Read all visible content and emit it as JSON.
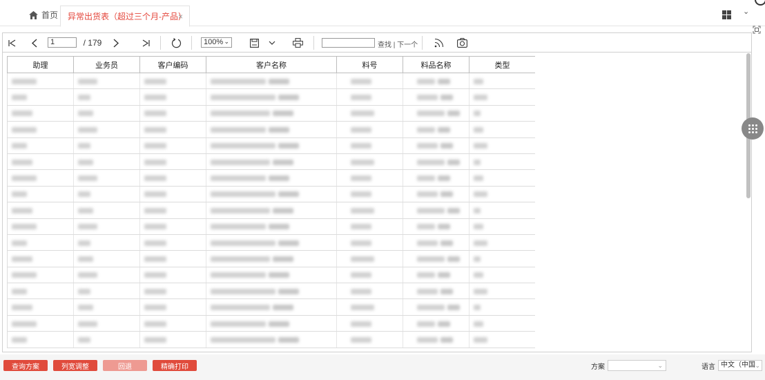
{
  "tabs": {
    "home_label": "首页",
    "active_label": "异常出货表（超过三个月-产品）",
    "close_glyph": "×"
  },
  "toolbar": {
    "first_page": "|◁",
    "prev_page": "〈",
    "page_current": "1",
    "page_total": "/ 179",
    "next_page": "〉",
    "last_page": "▷|",
    "zoom_value": "100%",
    "find_label": "查找 | 下一个"
  },
  "table": {
    "headers": [
      "助理",
      "业务员",
      "客户编码",
      "客户名称",
      "料号",
      "料品名称",
      "类型"
    ],
    "rows": [
      [
        "",
        "",
        "",
        "",
        "",
        "",
        ""
      ],
      [
        "",
        "",
        "",
        "",
        "",
        "",
        ""
      ],
      [
        "",
        "",
        "",
        "",
        "",
        "",
        ""
      ],
      [
        "",
        "",
        "",
        "",
        "",
        "",
        ""
      ],
      [
        "",
        "",
        "",
        "",
        "",
        "",
        ""
      ],
      [
        "",
        "",
        "",
        "",
        "",
        "",
        ""
      ],
      [
        "",
        "",
        "",
        "",
        "",
        "",
        ""
      ],
      [
        "",
        "",
        "",
        "",
        "",
        "",
        ""
      ],
      [
        "",
        "",
        "",
        "",
        "",
        "",
        ""
      ],
      [
        "",
        "",
        "",
        "",
        "",
        "",
        ""
      ],
      [
        "",
        "",
        "",
        "",
        "",
        "",
        ""
      ],
      [
        "",
        "",
        "",
        "",
        "",
        "",
        ""
      ],
      [
        "",
        "",
        "",
        "",
        "",
        "",
        ""
      ],
      [
        "",
        "",
        "",
        "",
        "",
        "",
        ""
      ],
      [
        "",
        "",
        "",
        "",
        "",
        "",
        ""
      ],
      [
        "",
        "",
        "",
        "",
        "",
        "",
        ""
      ],
      [
        "",
        "",
        "",
        "",
        "",
        "",
        ""
      ]
    ]
  },
  "bottom": {
    "btn_query_scheme": "查询方案",
    "btn_column_width": "列宽调整",
    "btn_back": "回退",
    "btn_precise_print": "精确打印",
    "scheme_label": "方案",
    "scheme_value": "",
    "language_label": "语言",
    "language_value": "中文（中国"
  },
  "colors": {
    "accent": "#e04b3c",
    "accent_disabled": "#ee9a92"
  }
}
